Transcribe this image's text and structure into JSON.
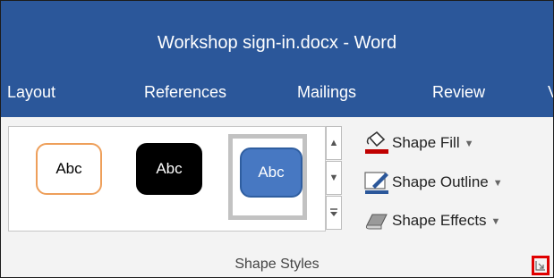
{
  "window": {
    "title": "Workshop sign-in.docx - Word"
  },
  "tabs": [
    {
      "label": "Layout"
    },
    {
      "label": "References"
    },
    {
      "label": "Mailings"
    },
    {
      "label": "Review"
    },
    {
      "label": "V"
    }
  ],
  "shape_styles": {
    "gallery": [
      {
        "label": "Abc",
        "style": "orange-outline",
        "fill": "#ffffff",
        "border": "#ee9f5a"
      },
      {
        "label": "Abc",
        "style": "black-fill",
        "fill": "#000000",
        "border": "#000000"
      },
      {
        "label": "Abc",
        "style": "blue-fill",
        "fill": "#4778c2",
        "border": "#2f5ea0",
        "selected": true
      }
    ],
    "scroll_icons": [
      "scroll-up-icon",
      "scroll-down-icon",
      "more-styles-icon"
    ],
    "commands": {
      "fill": {
        "label": "Shape Fill",
        "icon": "paint-bucket-icon"
      },
      "outline": {
        "label": "Shape Outline",
        "icon": "pen-outline-icon"
      },
      "effects": {
        "label": "Shape Effects",
        "icon": "shape-effects-icon"
      }
    },
    "group_label": "Shape Styles",
    "launcher_icon": "dialog-launcher-icon"
  },
  "colors": {
    "title_bar": "#2b579a",
    "ribbon": "#f3f3f3",
    "highlight": "#e00000",
    "fill_underline": "#c00000",
    "outline_underline": "#2b579a"
  }
}
